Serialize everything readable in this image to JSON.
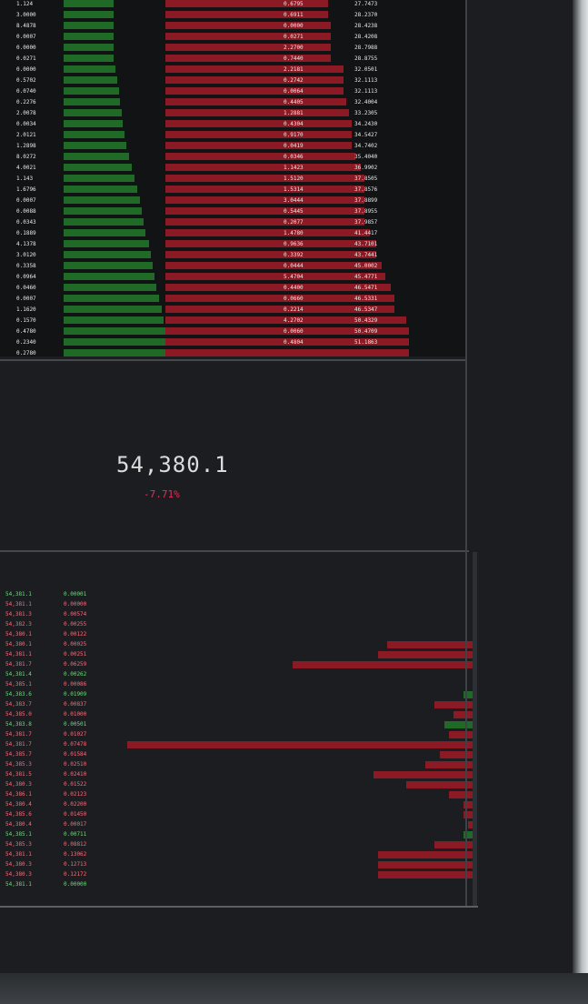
{
  "ticker": {
    "last_price": "54,380.1",
    "change": "-7.71%"
  },
  "colors": {
    "bid": "#6fdc7a",
    "ask": "#ff6a7a",
    "bid_bar": "#1f6a26",
    "ask_bar": "#8c1a24",
    "negative": "#e0305a"
  },
  "order_book": {
    "rows": [
      {
        "bid_size": "1.124",
        "bid_total": "",
        "ask_size": "0.6795",
        "ask_total": "27.7473",
        "bid_level": 0.0,
        "ask_level": 0.3
      },
      {
        "bid_size": "3.0000",
        "bid_total": "",
        "ask_size": "0.6911",
        "ask_total": "28.2370",
        "bid_level": 0.0,
        "ask_level": 0.3
      },
      {
        "bid_size": "8.4878",
        "bid_total": "",
        "ask_size": "0.0000",
        "ask_total": "28.4238",
        "bid_level": 0.0,
        "ask_level": 0.31
      },
      {
        "bid_size": "0.0007",
        "bid_total": "",
        "ask_size": "0.0271",
        "ask_total": "28.4208",
        "bid_level": 0.0,
        "ask_level": 0.31
      },
      {
        "bid_size": "0.0000",
        "bid_total": "",
        "ask_size": "2.2700",
        "ask_total": "28.7988",
        "bid_level": 0.0,
        "ask_level": 0.31
      },
      {
        "bid_size": "0.0271",
        "bid_total": "",
        "ask_size": "0.7440",
        "ask_total": "28.8755",
        "bid_level": 0.0,
        "ask_level": 0.31
      },
      {
        "bid_size": "0.0000",
        "bid_total": "",
        "ask_size": "2.2181",
        "ask_total": "32.0501",
        "bid_level": 0.02,
        "ask_level": 0.35
      },
      {
        "bid_size": "0.5702",
        "bid_total": "",
        "ask_size": "0.2742",
        "ask_total": "32.1113",
        "bid_level": 0.04,
        "ask_level": 0.35
      },
      {
        "bid_size": "0.0740",
        "bid_total": "",
        "ask_size": "0.0064",
        "ask_total": "32.1113",
        "bid_level": 0.05,
        "ask_level": 0.35
      },
      {
        "bid_size": "0.2276",
        "bid_total": "",
        "ask_size": "0.4405",
        "ask_total": "32.4004",
        "bid_level": 0.06,
        "ask_level": 0.36
      },
      {
        "bid_size": "2.0078",
        "bid_total": "",
        "ask_size": "1.2881",
        "ask_total": "33.2305",
        "bid_level": 0.08,
        "ask_level": 0.37
      },
      {
        "bid_size": "0.0034",
        "bid_total": "",
        "ask_size": "0.4304",
        "ask_total": "34.2430",
        "bid_level": 0.09,
        "ask_level": 0.38
      },
      {
        "bid_size": "2.0121",
        "bid_total": "",
        "ask_size": "0.9170",
        "ask_total": "34.5427",
        "bid_level": 0.11,
        "ask_level": 0.38
      },
      {
        "bid_size": "1.2898",
        "bid_total": "",
        "ask_size": "0.0419",
        "ask_total": "34.7402",
        "bid_level": 0.13,
        "ask_level": 0.38
      },
      {
        "bid_size": "8.0272",
        "bid_total": "",
        "ask_size": "0.0346",
        "ask_total": "35.4040",
        "bid_level": 0.15,
        "ask_level": 0.39
      },
      {
        "bid_size": "4.0021",
        "bid_total": "",
        "ask_size": "1.1423",
        "ask_total": "36.9902",
        "bid_level": 0.18,
        "ask_level": 0.41
      },
      {
        "bid_size": "1.143",
        "bid_total": "",
        "ask_size": "1.5120",
        "ask_total": "37.8505",
        "bid_level": 0.21,
        "ask_level": 0.42
      },
      {
        "bid_size": "1.6796",
        "bid_total": "",
        "ask_size": "1.5314",
        "ask_total": "37.8576",
        "bid_level": 0.24,
        "ask_level": 0.42
      },
      {
        "bid_size": "0.0007",
        "bid_total": "",
        "ask_size": "3.0444",
        "ask_total": "37.8899",
        "bid_level": 0.26,
        "ask_level": 0.42
      },
      {
        "bid_size": "0.0088",
        "bid_total": "",
        "ask_size": "0.5445",
        "ask_total": "37.8955",
        "bid_level": 0.28,
        "ask_level": 0.42
      },
      {
        "bid_size": "0.0343",
        "bid_total": "",
        "ask_size": "0.2077",
        "ask_total": "37.9857",
        "bid_level": 0.3,
        "ask_level": 0.42
      },
      {
        "bid_size": "0.1889",
        "bid_total": "",
        "ask_size": "1.4780",
        "ask_total": "41.4417",
        "bid_level": 0.32,
        "ask_level": 0.44
      },
      {
        "bid_size": "4.1378",
        "bid_total": "",
        "ask_size": "0.9636",
        "ask_total": "43.7101",
        "bid_level": 0.35,
        "ask_level": 0.46
      },
      {
        "bid_size": "3.0120",
        "bid_total": "",
        "ask_size": "0.3392",
        "ask_total": "43.7441",
        "bid_level": 0.37,
        "ask_level": 0.46
      },
      {
        "bid_size": "0.3358",
        "bid_total": "",
        "ask_size": "0.0444",
        "ask_total": "45.0002",
        "bid_level": 0.39,
        "ask_level": 0.48
      },
      {
        "bid_size": "0.0964",
        "bid_total": "",
        "ask_size": "5.4704",
        "ask_total": "45.4771",
        "bid_level": 0.41,
        "ask_level": 0.49
      },
      {
        "bid_size": "0.0460",
        "bid_total": "",
        "ask_size": "0.4400",
        "ask_total": "46.5471",
        "bid_level": 0.43,
        "ask_level": 0.51
      },
      {
        "bid_size": "0.0007",
        "bid_total": "",
        "ask_size": "0.0660",
        "ask_total": "46.5331",
        "bid_level": 0.45,
        "ask_level": 0.52
      },
      {
        "bid_size": "1.1620",
        "bid_total": "",
        "ask_size": "0.2214",
        "ask_total": "46.5347",
        "bid_level": 0.48,
        "ask_level": 0.52
      },
      {
        "bid_size": "0.1570",
        "bid_total": "",
        "ask_size": "4.2702",
        "ask_total": "50.4329",
        "bid_level": 0.5,
        "ask_level": 0.56
      },
      {
        "bid_size": "0.4780",
        "bid_total": "",
        "ask_size": "0.0060",
        "ask_total": "50.4709",
        "bid_level": 0.52,
        "ask_level": 0.57
      },
      {
        "bid_size": "0.2340",
        "bid_total": "",
        "ask_size": "0.4804",
        "ask_total": "51.1863",
        "bid_level": 0.54,
        "ask_level": 0.57
      },
      {
        "bid_size": "0.2780",
        "bid_total": "",
        "ask_size": "",
        "ask_total": "",
        "bid_level": 0.55,
        "ask_level": 0.57
      }
    ]
  },
  "trades": {
    "rows": [
      {
        "price": "54,381.1",
        "size": "0.00001",
        "side": "buy",
        "level": 0.0
      },
      {
        "price": "54,381.1",
        "size": "0.00000",
        "side": "sell",
        "level": 0.0
      },
      {
        "price": "54,381.3",
        "size": "0.00574",
        "side": "sell",
        "level": 0.0
      },
      {
        "price": "54,382.3",
        "size": "0.00255",
        "side": "sell",
        "level": 0.0
      },
      {
        "price": "54,380.1",
        "size": "0.00122",
        "side": "sell",
        "level": 0.0
      },
      {
        "price": "54,380.1",
        "size": "0.00025",
        "side": "sell",
        "level": 0.18
      },
      {
        "price": "54,381.1",
        "size": "0.00251",
        "side": "sell",
        "level": 0.2
      },
      {
        "price": "54,381.7",
        "size": "0.06259",
        "side": "sell",
        "level": 0.38
      },
      {
        "price": "54,381.4",
        "size": "0.00262",
        "side": "buy",
        "level": 0.0
      },
      {
        "price": "54,385.1",
        "size": "0.00086",
        "side": "sell",
        "level": 0.0
      },
      {
        "price": "54,383.6",
        "size": "0.01909",
        "side": "buy",
        "level": 0.02
      },
      {
        "price": "54,383.7",
        "size": "0.00837",
        "side": "sell",
        "level": 0.08
      },
      {
        "price": "54,385.0",
        "size": "0.01000",
        "side": "sell",
        "level": 0.04
      },
      {
        "price": "54,383.8",
        "size": "0.00501",
        "side": "buy",
        "level": 0.06
      },
      {
        "price": "54,381.7",
        "size": "0.01027",
        "side": "sell",
        "level": 0.05
      },
      {
        "price": "54,381.7",
        "size": "0.07478",
        "side": "sell",
        "level": 0.73
      },
      {
        "price": "54,385.7",
        "size": "0.01584",
        "side": "sell",
        "level": 0.07
      },
      {
        "price": "54,385.3",
        "size": "0.02510",
        "side": "sell",
        "level": 0.1
      },
      {
        "price": "54,381.5",
        "size": "0.02410",
        "side": "sell",
        "level": 0.21
      },
      {
        "price": "54,380.3",
        "size": "0.01522",
        "side": "sell",
        "level": 0.14
      },
      {
        "price": "54,386.1",
        "size": "0.02123",
        "side": "sell",
        "level": 0.05
      },
      {
        "price": "54,380.4",
        "size": "0.02200",
        "side": "sell",
        "level": 0.02
      },
      {
        "price": "54,385.6",
        "size": "0.01450",
        "side": "sell",
        "level": 0.02
      },
      {
        "price": "54,380.4",
        "size": "0.00017",
        "side": "sell",
        "level": 0.01
      },
      {
        "price": "54,385.1",
        "size": "0.00711",
        "side": "buy",
        "level": 0.02
      },
      {
        "price": "54,385.3",
        "size": "0.08812",
        "side": "sell",
        "level": 0.08
      },
      {
        "price": "54,381.1",
        "size": "0.13062",
        "side": "sell",
        "level": 0.2
      },
      {
        "price": "54,380.3",
        "size": "0.12713",
        "side": "sell",
        "level": 0.2
      },
      {
        "price": "54,380.3",
        "size": "0.12172",
        "side": "sell",
        "level": 0.2
      },
      {
        "price": "54,381.1",
        "size": "0.00000",
        "side": "buy",
        "level": 0.0
      }
    ]
  }
}
